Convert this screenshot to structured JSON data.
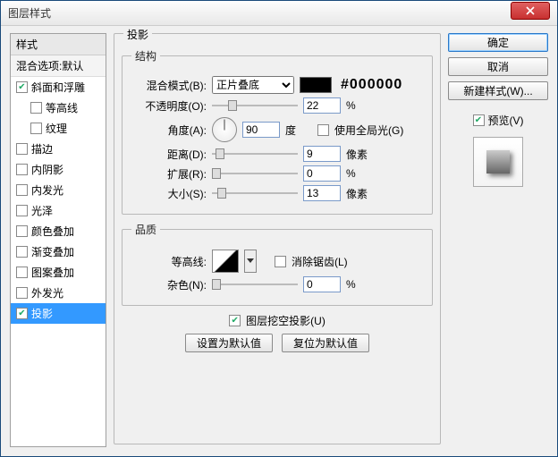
{
  "window": {
    "title": "图层样式"
  },
  "buttons": {
    "ok": "确定",
    "cancel": "取消",
    "new_style": "新建样式(W)...",
    "set_default": "设置为默认值",
    "reset_default": "复位为默认值"
  },
  "left": {
    "header": "样式",
    "blending_options": "混合选项:默认",
    "items": [
      {
        "label": "斜面和浮雕",
        "checked": true,
        "selected": false,
        "indent": false
      },
      {
        "label": "等高线",
        "checked": false,
        "selected": false,
        "indent": true
      },
      {
        "label": "纹理",
        "checked": false,
        "selected": false,
        "indent": true
      },
      {
        "label": "描边",
        "checked": false,
        "selected": false,
        "indent": false
      },
      {
        "label": "内阴影",
        "checked": false,
        "selected": false,
        "indent": false
      },
      {
        "label": "内发光",
        "checked": false,
        "selected": false,
        "indent": false
      },
      {
        "label": "光泽",
        "checked": false,
        "selected": false,
        "indent": false
      },
      {
        "label": "颜色叠加",
        "checked": false,
        "selected": false,
        "indent": false
      },
      {
        "label": "渐变叠加",
        "checked": false,
        "selected": false,
        "indent": false
      },
      {
        "label": "图案叠加",
        "checked": false,
        "selected": false,
        "indent": false
      },
      {
        "label": "外发光",
        "checked": false,
        "selected": false,
        "indent": false
      },
      {
        "label": "投影",
        "checked": true,
        "selected": true,
        "indent": false
      }
    ]
  },
  "panel": {
    "outer_title": "投影",
    "structure": {
      "legend": "结构",
      "blend_mode_label": "混合模式(B):",
      "blend_mode_value": "正片叠底",
      "color_hex": "#000000",
      "opacity_label": "不透明度(O):",
      "opacity_value": "22",
      "opacity_unit": "%",
      "angle_label": "角度(A):",
      "angle_value": "90",
      "angle_unit": "度",
      "global_light_label": "使用全局光(G)",
      "global_light_checked": false,
      "distance_label": "距离(D):",
      "distance_value": "9",
      "distance_unit": "像素",
      "spread_label": "扩展(R):",
      "spread_value": "0",
      "spread_unit": "%",
      "size_label": "大小(S):",
      "size_value": "13",
      "size_unit": "像素"
    },
    "quality": {
      "legend": "品质",
      "contour_label": "等高线:",
      "antialias_label": "消除锯齿(L)",
      "antialias_checked": false,
      "noise_label": "杂色(N):",
      "noise_value": "0",
      "noise_unit": "%"
    },
    "knockout_label": "图层挖空投影(U)",
    "knockout_checked": true
  },
  "preview": {
    "label": "预览(V)",
    "checked": true
  }
}
